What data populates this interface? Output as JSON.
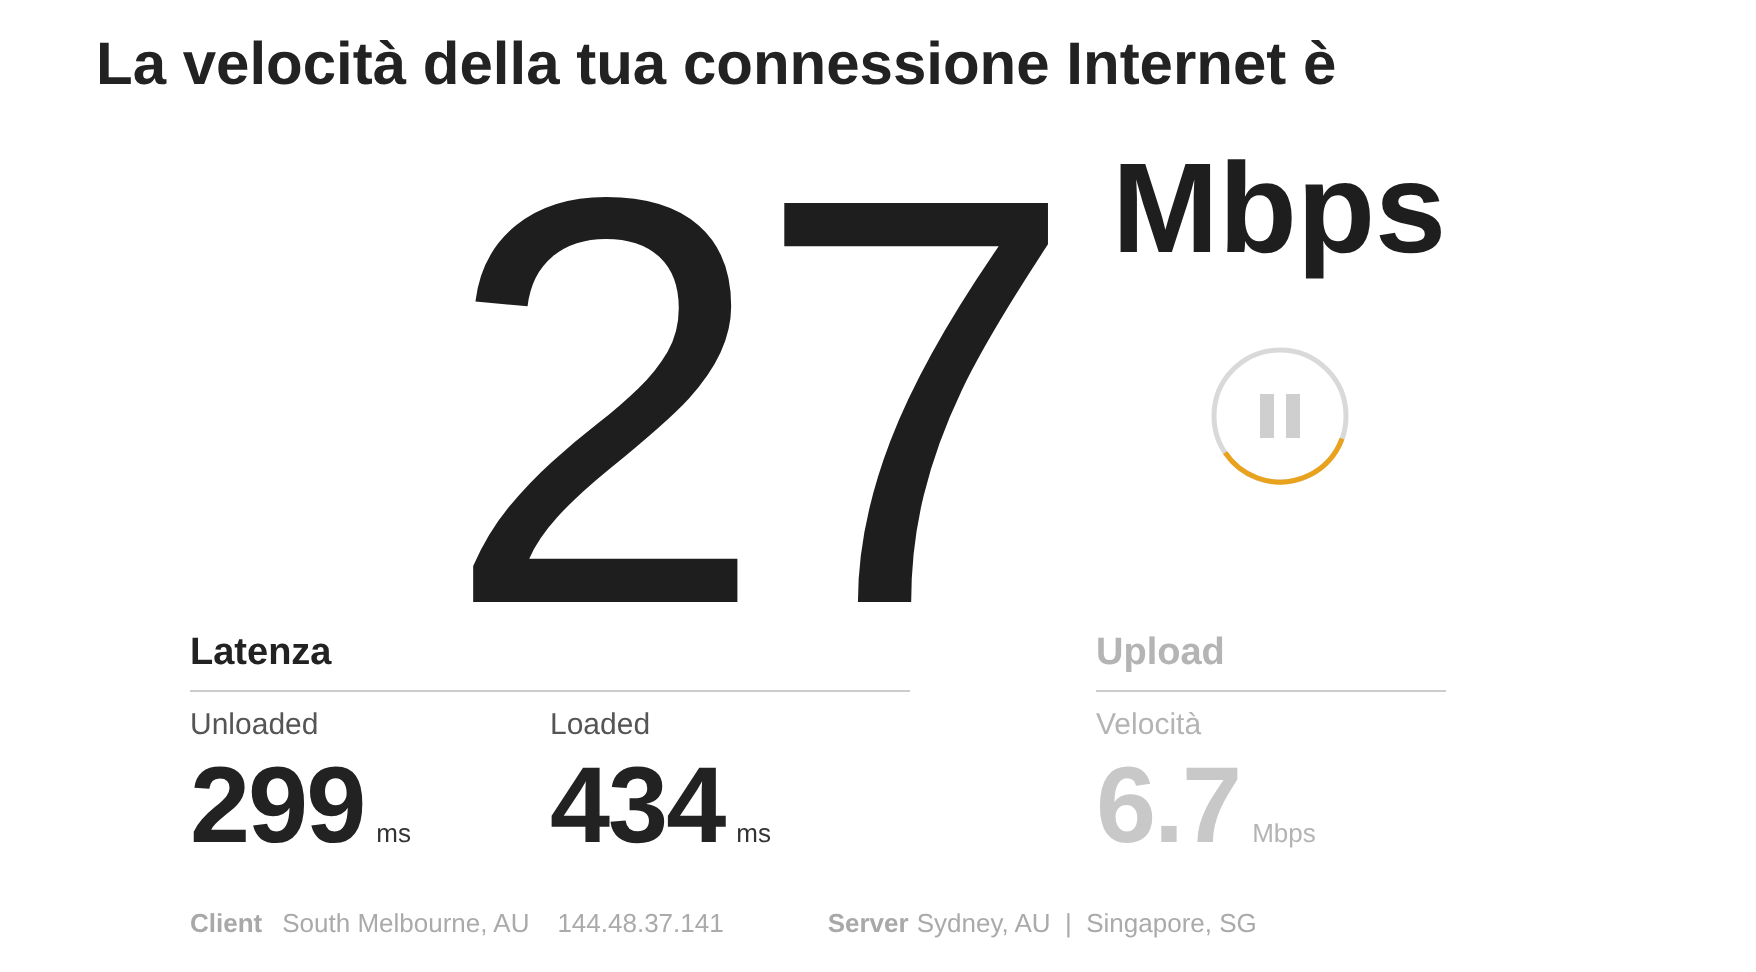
{
  "title": "La velocità della tua connessione Internet è",
  "speed": {
    "value": "27",
    "unit": "Mbps",
    "pause_button": {
      "progress": {
        "level": 0.35
      }
    }
  },
  "groups": [
    {
      "heading": "Latenza",
      "disabled": false,
      "metrics": [
        {
          "label": "Unloaded",
          "value": "299",
          "unit": "ms"
        },
        {
          "label": "Loaded",
          "value": "434",
          "unit": "ms"
        }
      ]
    },
    {
      "heading": "Upload",
      "disabled": true,
      "metrics": [
        {
          "label": "Velocità",
          "value": "6.7",
          "unit": "Mbps"
        }
      ]
    }
  ],
  "footer": {
    "client": {
      "label": "Client",
      "location": "South Melbourne, AU",
      "ip": "144.48.37.141"
    },
    "server": {
      "label": "Server",
      "locations": "Sydney, AU  |  Singapore, SG"
    }
  }
}
